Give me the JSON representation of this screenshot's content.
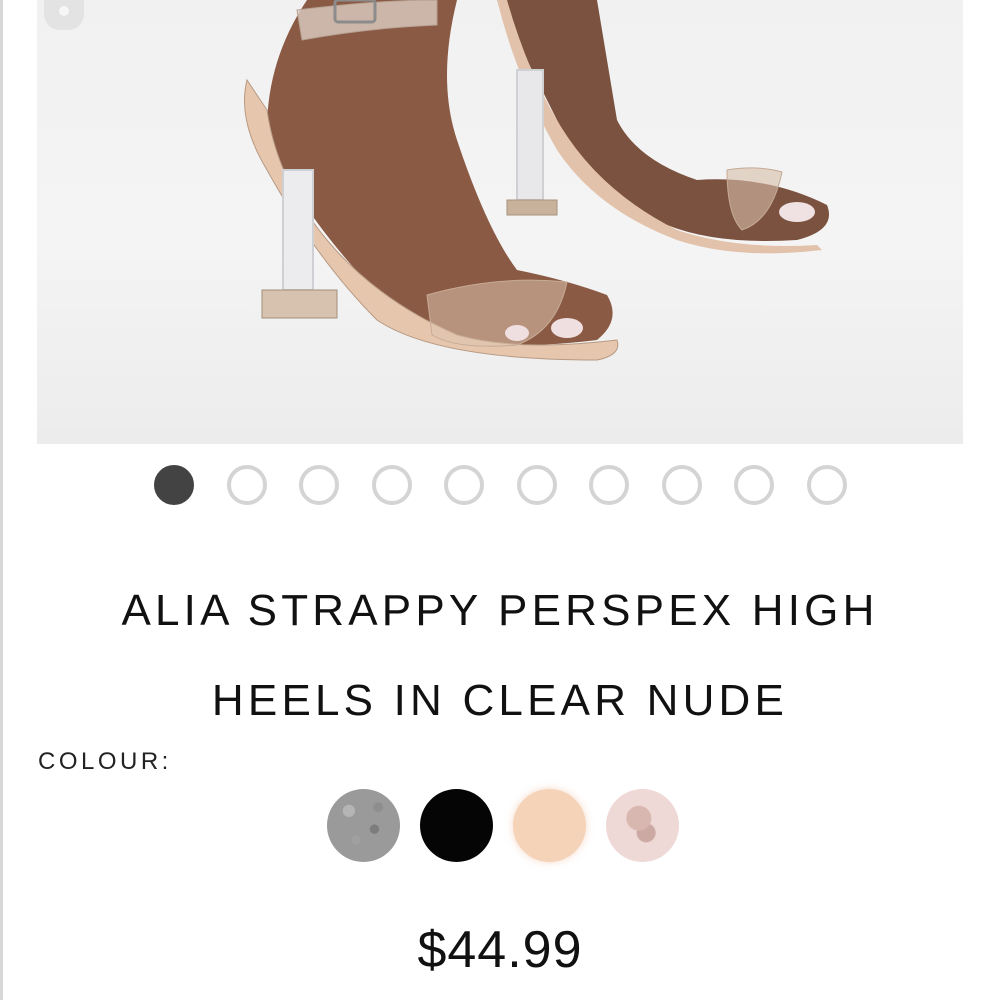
{
  "product": {
    "image_alt": "Clear perspex strappy high heels",
    "gallery": {
      "count": 10,
      "active_index": 0
    },
    "title_line1": "ALIA STRAPPY PERSPEX HIGH",
    "title_line2": "HEELS IN CLEAR NUDE",
    "colour_label": "COLOUR:",
    "colours": [
      {
        "name": "silver-glitter",
        "hex": "#9a9a9a"
      },
      {
        "name": "black",
        "hex": "#050505"
      },
      {
        "name": "nude",
        "hex": "#f5d3b8"
      },
      {
        "name": "rose-gold",
        "hex": "#efd9d6"
      }
    ],
    "price": "$44.99"
  }
}
